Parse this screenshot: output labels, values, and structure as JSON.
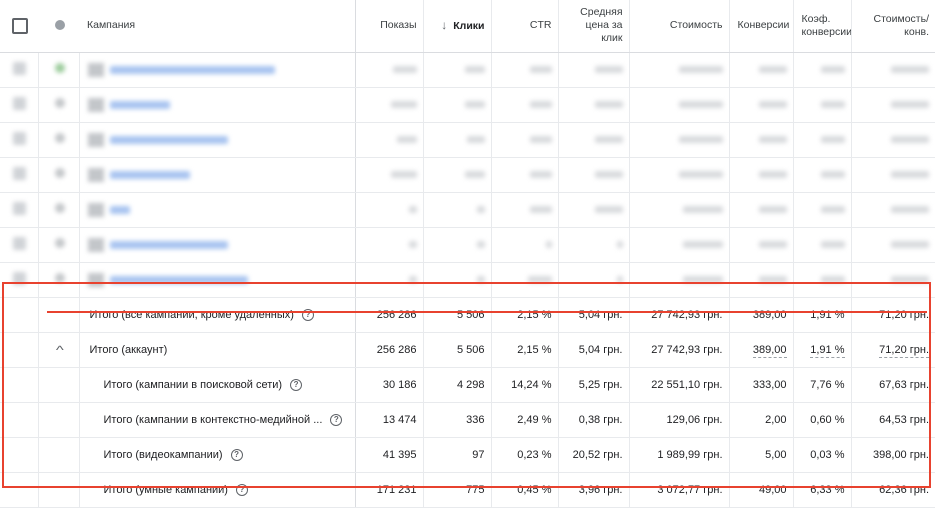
{
  "header": {
    "campaign": "Кампания",
    "impressions": "Показы",
    "clicks": "Клики",
    "ctr": "CTR",
    "avg_cpc": "Средняя цена за клик",
    "cost": "Стоимость",
    "conversions": "Конверсии",
    "conv_rate": "Коэф. конверсии",
    "cost_per_conv": "Стоимость/ конв.",
    "sort_icon": "arrow-down-icon"
  },
  "totals": [
    {
      "label": "Итого (все кампании, кроме удаленных)",
      "impressions": "256 286",
      "clicks": "5 506",
      "ctr": "2,15 %",
      "avg_cpc": "5,04 грн.",
      "cost": "27 742,93 грн.",
      "conversions": "389,00",
      "conv_rate": "1,91 %",
      "cost_per_conv": "71,20 грн."
    },
    {
      "label": "Итого (аккаунт)",
      "impressions": "256 286",
      "clicks": "5 506",
      "ctr": "2,15 %",
      "avg_cpc": "5,04 грн.",
      "cost": "27 742,93 грн.",
      "conversions": "389,00",
      "conv_rate": "1,91 %",
      "cost_per_conv": "71,20 грн."
    },
    {
      "label": "Итого (кампании в поисковой сети)",
      "impressions": "30 186",
      "clicks": "4 298",
      "ctr": "14,24 %",
      "avg_cpc": "5,25 грн.",
      "cost": "22 551,10 грн.",
      "conversions": "333,00",
      "conv_rate": "7,76 %",
      "cost_per_conv": "67,63 грн."
    },
    {
      "label": "Итого (кампании в контекстно-медийной ...",
      "impressions": "13 474",
      "clicks": "336",
      "ctr": "2,49 %",
      "avg_cpc": "0,38 грн.",
      "cost": "129,06 грн.",
      "conversions": "2,00",
      "conv_rate": "0,60 %",
      "cost_per_conv": "64,53 грн."
    },
    {
      "label": "Итого (видеокампании)",
      "impressions": "41 395",
      "clicks": "97",
      "ctr": "0,23 %",
      "avg_cpc": "20,52 грн.",
      "cost": "1 989,99 грн.",
      "conversions": "5,00",
      "conv_rate": "0,03 %",
      "cost_per_conv": "398,00 грн."
    },
    {
      "label": "Итого (умные кампании)",
      "impressions": "171 231",
      "clicks": "775",
      "ctr": "0,45 %",
      "avg_cpc": "3,96 грн.",
      "cost": "3 072,77 грн.",
      "conversions": "49,00",
      "conv_rate": "6,33 %",
      "cost_per_conv": "62,36 грн."
    }
  ],
  "icons": {
    "help": "help-circle-icon",
    "collapse": "chevron-up-icon",
    "help_glyph": "?",
    "collapse_glyph": "^"
  },
  "colors": {
    "highlight": "#e8422f",
    "header_text": "#3c4043",
    "blurred_link": "#a8c4f0"
  }
}
